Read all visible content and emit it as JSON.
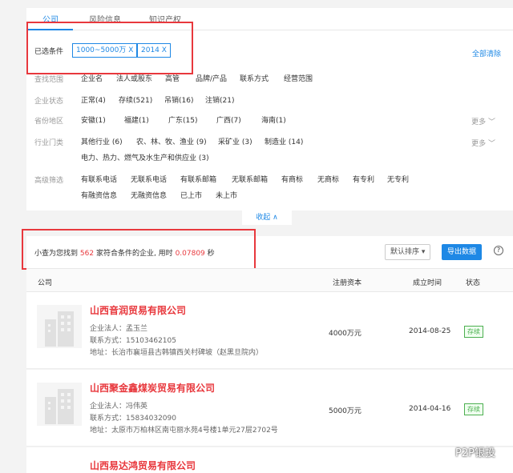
{
  "tabs": [
    "公司",
    "风险信息",
    "知识产权"
  ],
  "selected": {
    "label": "已选条件",
    "chips": [
      "1000~5000万 X",
      "2014 X"
    ],
    "clear_all": "全部清除"
  },
  "filters": {
    "scope": {
      "label": "查找范围",
      "options": [
        "企业名",
        "法人或股东",
        "高管",
        "品牌/产品",
        "联系方式",
        "经营范围"
      ]
    },
    "state": {
      "label": "企业状态",
      "options": [
        "正常(4)",
        "存续(521)",
        "吊销(16)",
        "注销(21)"
      ]
    },
    "region": {
      "label": "省份地区",
      "options": [
        "安徽(1)",
        "福建(1)",
        "广东(15)",
        "广西(7)",
        "海南(1)"
      ],
      "more": "更多"
    },
    "industry": {
      "label": "行业门类",
      "options": [
        "其他行业 (6)",
        "农、林、牧、渔业 (9)",
        "采矿业 (3)",
        "制造业 (14)"
      ],
      "options2": [
        "电力、热力、燃气及水生产和供应业 (3)"
      ],
      "more": "更多"
    },
    "advanced": {
      "label": "高级筛选",
      "options": [
        "有联系电话",
        "无联系电话",
        "有联系邮箱",
        "无联系邮箱",
        "有商标",
        "无商标",
        "有专利",
        "无专利"
      ],
      "options2": [
        "有融资信息",
        "无融资信息",
        "已上市",
        "未上市"
      ]
    },
    "collapse": "收起 ∧"
  },
  "result": {
    "prefix": "小查为您找到",
    "count": "562",
    "middle": "家符合条件的企业, 用时",
    "time": "0.07809",
    "suffix": "秒",
    "sort": "默认排序 ▾",
    "export": "导出数据",
    "help": "?"
  },
  "table": {
    "headers": [
      "公司",
      "注册资本",
      "成立时间",
      "状态"
    ],
    "rows": [
      {
        "name": "山西音润贸易有限公司",
        "legal": "企业法人：孟玉兰",
        "phone": "联系方式：15103462105",
        "addr": "地址：长治市襄垣县古韩镇西关村碑坡（赵黑旦院内）",
        "capital": "4000万元",
        "date": "2014-08-25",
        "status": "存续"
      },
      {
        "name": "山西聚金鑫煤炭贸易有限公司",
        "legal": "企业法人：冯伟英",
        "phone": "联系方式：15834032090",
        "addr": "地址：太原市万柏林区南屯丽水苑4号楼1单元27层2702号",
        "capital": "5000万元",
        "date": "2014-04-16",
        "status": "存续"
      },
      {
        "name": "山西易达鸿贸易有限公司"
      }
    ]
  },
  "watermark": "P2P银投"
}
